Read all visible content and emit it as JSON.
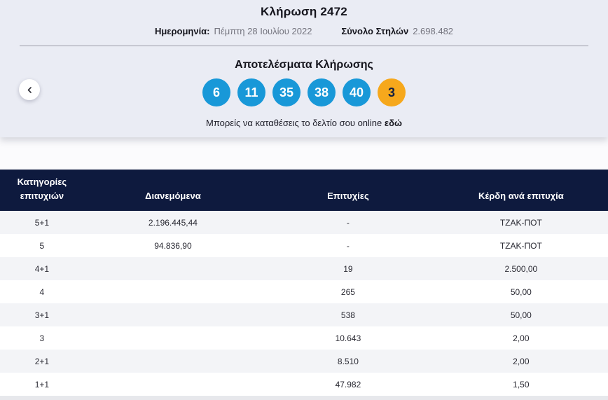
{
  "colors": {
    "panel_bg": "#eaecf4",
    "ball_blue": "#1898d8",
    "ball_joker_orange": "#f6a81c",
    "table_header_navy": "#0e1a3e",
    "row_alt_gray": "#f3f4f7",
    "muted_text": "#74747e"
  },
  "header": {
    "title": "Κλήρωση 2472",
    "date_label": "Ημερομηνία:",
    "date_value": "Πέμπτη 28 Ιουλίου 2022",
    "columns_label": "Σύνολο Στηλών",
    "columns_value": "2.698.482"
  },
  "results": {
    "heading": "Αποτελέσματα Κλήρωσης",
    "numbers": [
      "6",
      "11",
      "35",
      "38",
      "40"
    ],
    "joker": "3",
    "online_text": "Μπορείς να καταθέσεις το δελτίο σου online",
    "online_link": "εδώ"
  },
  "table": {
    "headers": [
      "Κατηγορίες επιτυχιών",
      "Διανεμόμενα",
      "Επιτυχίες",
      "Κέρδη ανά επιτυχία"
    ],
    "rows": [
      {
        "category": "5+1",
        "distributed": "2.196.445,44",
        "winners": "-",
        "prize": "ΤΖΑΚ-ΠΟΤ"
      },
      {
        "category": "5",
        "distributed": "94.836,90",
        "winners": "-",
        "prize": "ΤΖΑΚ-ΠΟΤ"
      },
      {
        "category": "4+1",
        "distributed": "",
        "winners": "19",
        "prize": "2.500,00"
      },
      {
        "category": "4",
        "distributed": "",
        "winners": "265",
        "prize": "50,00"
      },
      {
        "category": "3+1",
        "distributed": "",
        "winners": "538",
        "prize": "50,00"
      },
      {
        "category": "3",
        "distributed": "",
        "winners": "10.643",
        "prize": "2,00"
      },
      {
        "category": "2+1",
        "distributed": "",
        "winners": "8.510",
        "prize": "2,00"
      },
      {
        "category": "1+1",
        "distributed": "",
        "winners": "47.982",
        "prize": "1,50"
      }
    ]
  }
}
